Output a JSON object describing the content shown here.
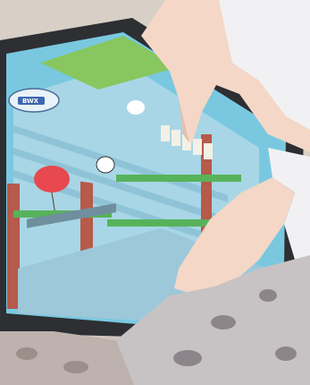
{
  "scene": {
    "description_hidden": "",
    "blimp_text": "BWX",
    "colors": {
      "sky": "#79c8e0",
      "building": "#a8d6e6",
      "brick": "#b65a4a",
      "grass": "#88c660",
      "balloon": "#e8484f",
      "tablet_frame": "#2d2f33",
      "skin": "#f4d7c7",
      "shirt": "#f1f1f3"
    }
  }
}
